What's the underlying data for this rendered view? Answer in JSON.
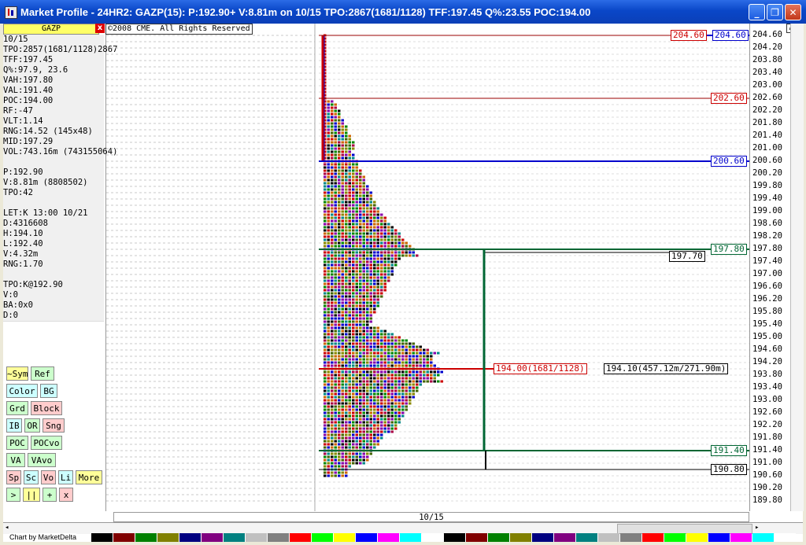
{
  "window": {
    "title": "Market Profile - 24HR2: GAZP(15): P:192.90+ V:8.81m on 10/15 TPO:2867(1681/1128) TFF:197.45 Q%:23.55 POC:194.00",
    "minimize": "_",
    "restore": "❐",
    "close": "✕"
  },
  "symbol": "GAZP",
  "symbol_close": "x",
  "copyright": "©2008 CME. All Rights Reserved",
  "stats": [
    "10/15",
    "TPO:2857(1681/1128)2867",
    "TFF:197.45",
    " Q%:97.9, 23.6",
    "VAH:197.80",
    "VAL:191.40",
    "POC:194.00",
    " RF:-47",
    "VLT:1.14",
    "RNG:14.52 (145x48)",
    "MID:197.29",
    "VOL:743.16m (743155064)",
    "",
    "  P:192.90",
    "  V:8.81m (8808502)",
    "TPO:42",
    "",
    "LET:K 13:00 10/21",
    "  D:4316608",
    "  H:194.10",
    "  L:192.40",
    "  V:4.32m",
    "RNG:1.70",
    "",
    "TPO:K@192.90",
    "  V:0",
    " BA:0x0",
    "  D:0"
  ],
  "buttons": [
    [
      {
        "label": "~Sym",
        "bg": "#ffff99"
      },
      {
        "label": "Ref",
        "bg": "#ccffcc"
      }
    ],
    [
      {
        "label": "Color",
        "bg": "#ccffff"
      },
      {
        "label": "BG",
        "bg": "#ccffff"
      }
    ],
    [
      {
        "label": "Grd",
        "bg": "#ccffcc"
      },
      {
        "label": "Block",
        "bg": "#ffcccc"
      }
    ],
    [
      {
        "label": "IB",
        "bg": "#ccffff"
      },
      {
        "label": "OR",
        "bg": "#ccffcc"
      },
      {
        "label": "Sng",
        "bg": "#ffcccc"
      }
    ],
    [
      {
        "label": "POC",
        "bg": "#ccffcc"
      },
      {
        "label": "POCvo",
        "bg": "#ccffcc"
      }
    ],
    [
      {
        "label": "VA",
        "bg": "#ccffcc"
      },
      {
        "label": "VAvo",
        "bg": "#ccffcc"
      }
    ],
    [
      {
        "label": "Sp",
        "bg": "#ffcccc"
      },
      {
        "label": "Sc",
        "bg": "#ccffff"
      },
      {
        "label": "Vo",
        "bg": "#ffcccc"
      },
      {
        "label": "Li",
        "bg": "#ccffff"
      },
      {
        "label": "More",
        "bg": "#ffff99"
      }
    ],
    [
      {
        "label": ">",
        "bg": "#ccffcc"
      },
      {
        "label": "||",
        "bg": "#ffff99"
      },
      {
        "label": "+",
        "bg": "#ccffcc"
      },
      {
        "label": "x",
        "bg": "#ffcccc"
      }
    ]
  ],
  "date_label": "10/15",
  "footer_label": "Chart by MarketDelta",
  "axis_labels": [
    "204.60",
    "204.20",
    "203.80",
    "203.40",
    "203.00",
    "202.60",
    "202.20",
    "201.80",
    "201.40",
    "201.00",
    "200.60",
    "200.20",
    "199.80",
    "199.40",
    "199.00",
    "198.60",
    "198.20",
    "197.80",
    "197.40",
    "197.00",
    "196.60",
    "196.20",
    "195.80",
    "195.40",
    "195.00",
    "194.60",
    "194.20",
    "193.80",
    "193.40",
    "193.00",
    "192.60",
    "192.20",
    "191.80",
    "191.40",
    "191.00",
    "190.60",
    "190.20",
    "189.80"
  ],
  "price_boxes": {
    "high": "204.60",
    "high_blue": "204.60",
    "red_202": "202.60",
    "blue_200": "200.60",
    "vah": "197.80",
    "black_197": "197.70",
    "poc": "194.00(1681/1128)",
    "poc_vol": "194.10(457.12m/271.90m)",
    "val": "191.40",
    "low": "190.80"
  },
  "colors": {
    "red": "#cc0000",
    "blue": "#0000cc",
    "green": "#006633",
    "black": "#000000"
  },
  "palette": [
    "#000000",
    "#800000",
    "#008000",
    "#808000",
    "#000080",
    "#800080",
    "#008080",
    "#c0c0c0",
    "#808080",
    "#ff0000",
    "#00ff00",
    "#ffff00",
    "#0000ff",
    "#ff00ff",
    "#00ffff",
    "#ffffff",
    "#000000",
    "#800000",
    "#008000",
    "#808000",
    "#000080",
    "#800080",
    "#008080",
    "#c0c0c0",
    "#808080",
    "#ff0000",
    "#00ff00",
    "#ffff00",
    "#0000ff",
    "#ff00ff",
    "#00ffff",
    "#ffffff"
  ]
}
